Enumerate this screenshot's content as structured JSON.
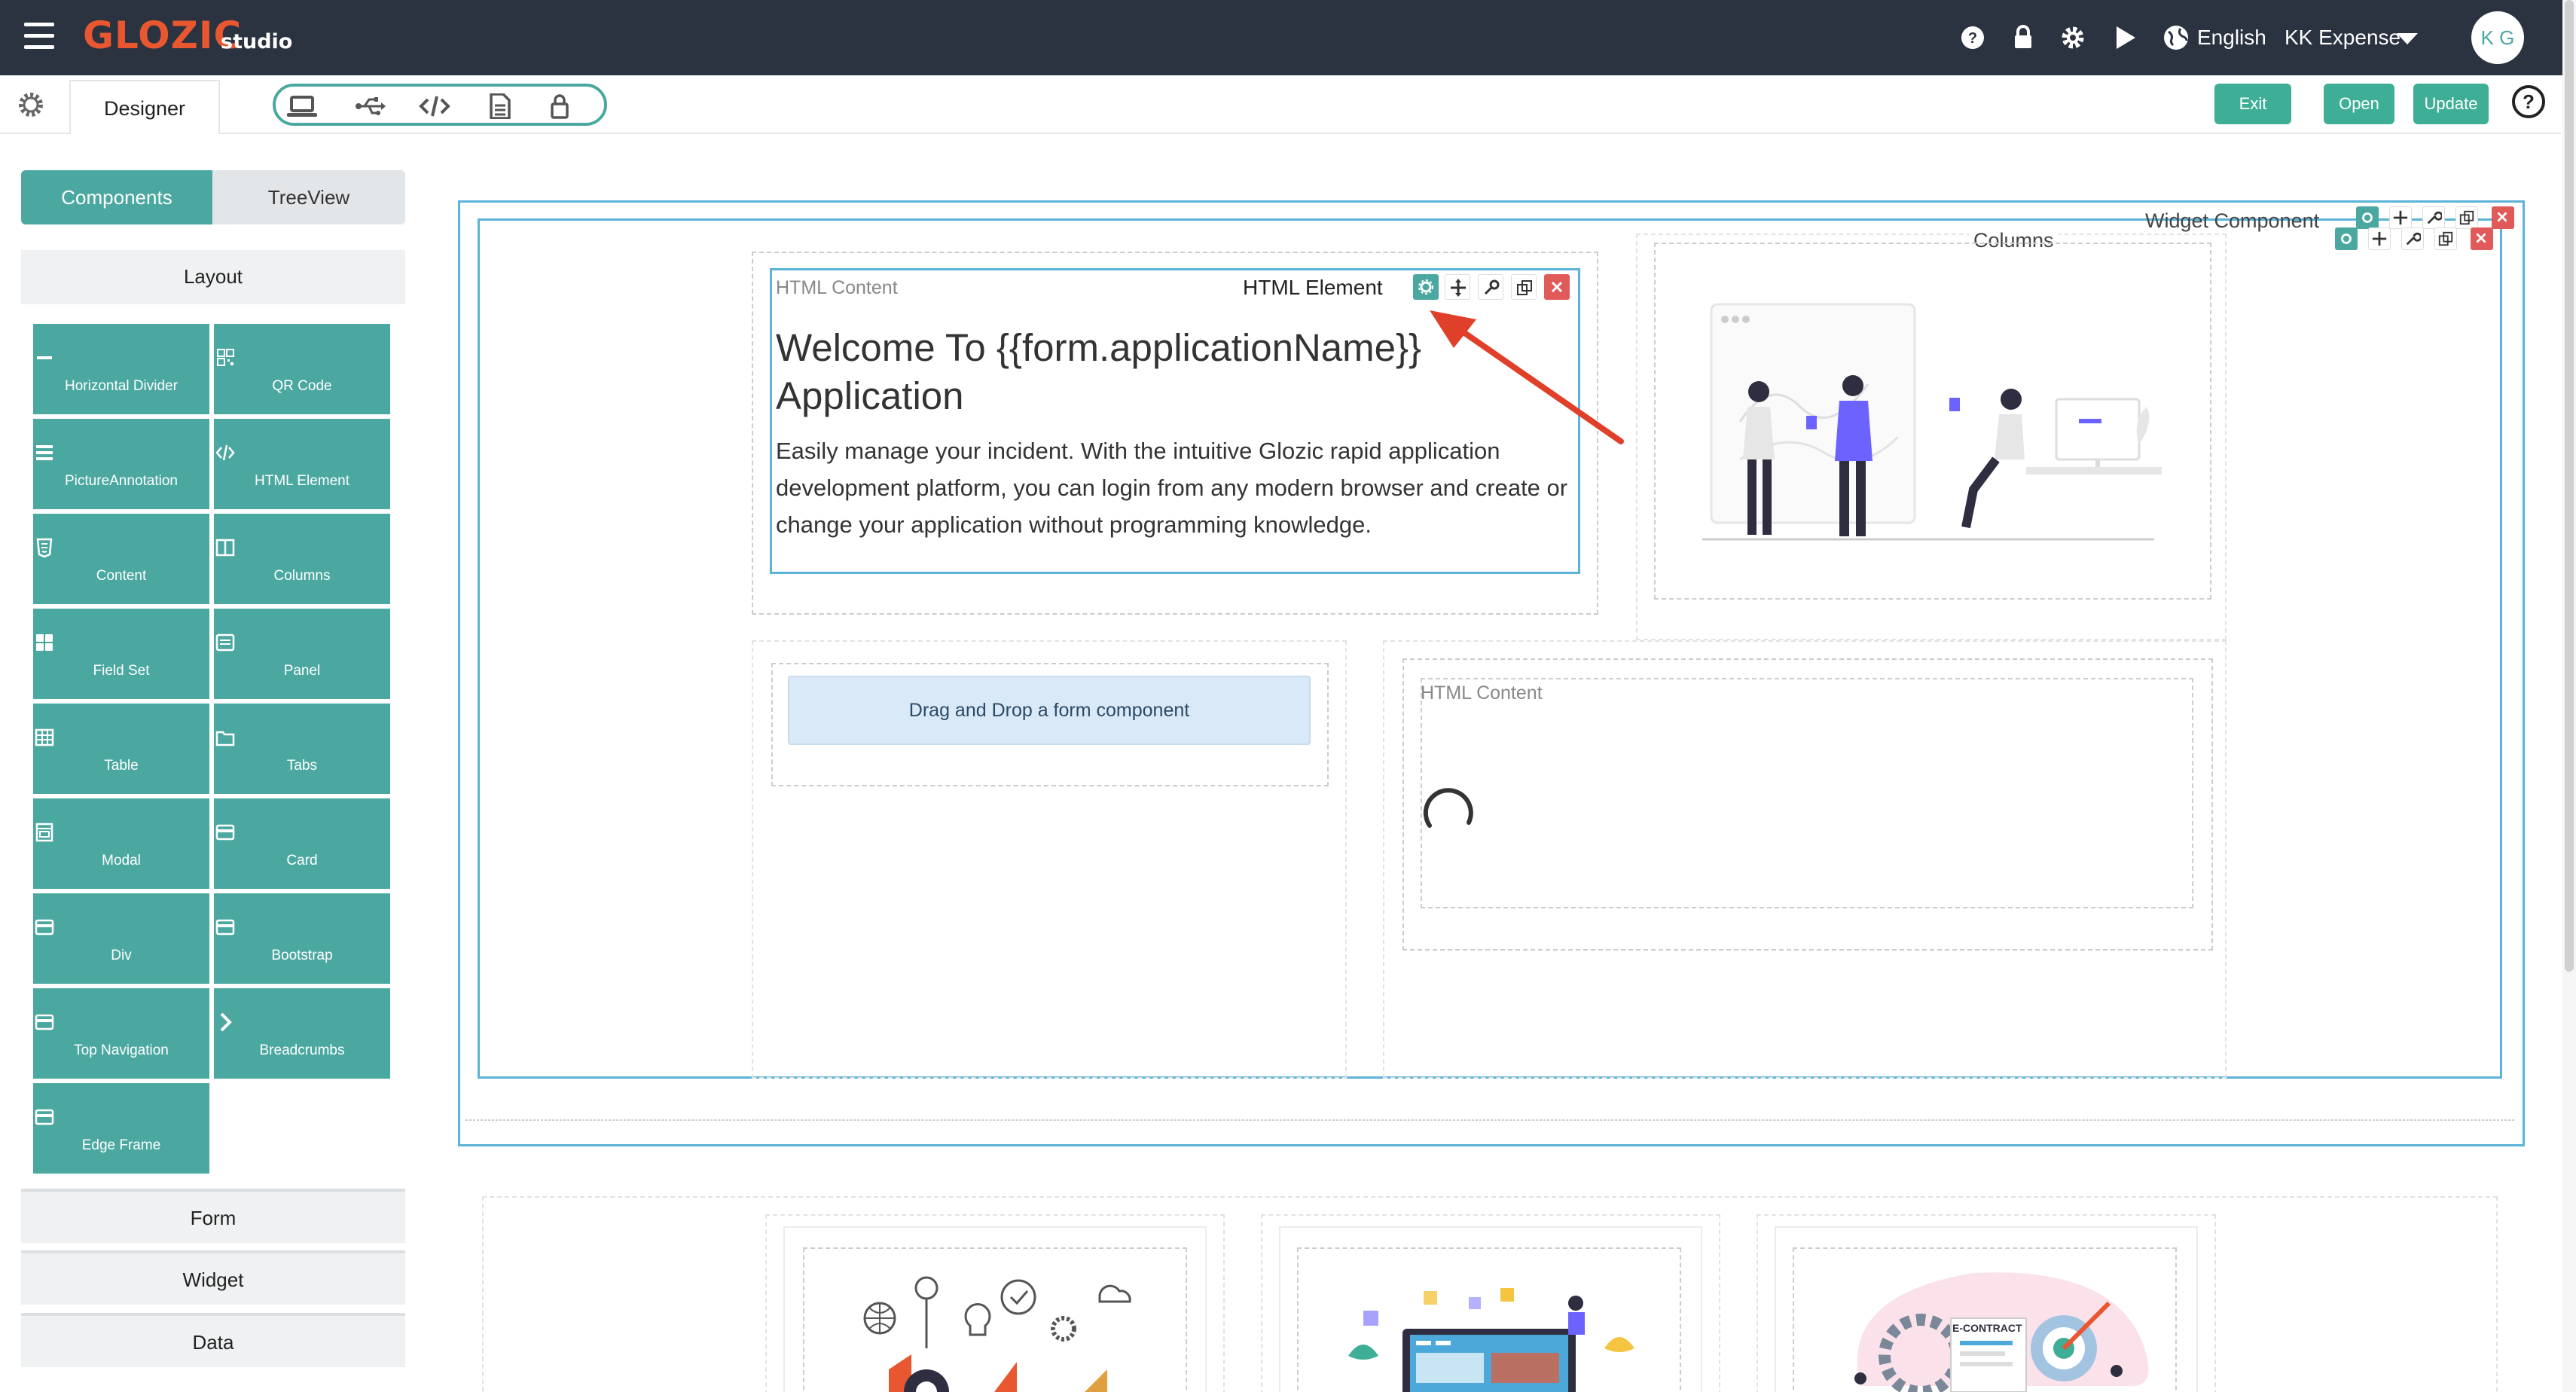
{
  "app": {
    "logo_text": "GLOZIC",
    "logo_sub": "studio",
    "language": "English",
    "account": "KK Expense",
    "avatar_initials": "K G"
  },
  "toolbar": {
    "designer_tab": "Designer",
    "exit_label": "Exit",
    "open_label": "Open",
    "update_label": "Update"
  },
  "left_panel": {
    "tab_components": "Components",
    "tab_treeview": "TreeView",
    "section_layout": "Layout",
    "components": [
      {
        "label": "Horizontal Divider",
        "icon": "minus-icon"
      },
      {
        "label": "QR Code",
        "icon": "qrcode-icon"
      },
      {
        "label": "PictureAnnotation",
        "icon": "bars-icon"
      },
      {
        "label": "HTML Element",
        "icon": "code-icon"
      },
      {
        "label": "Content",
        "icon": "html5-icon"
      },
      {
        "label": "Columns",
        "icon": "columns-icon"
      },
      {
        "label": "Field Set",
        "icon": "th-large-icon"
      },
      {
        "label": "Panel",
        "icon": "list-alt-icon"
      },
      {
        "label": "Table",
        "icon": "table-icon"
      },
      {
        "label": "Tabs",
        "icon": "folder-icon"
      },
      {
        "label": "Modal",
        "icon": "window-icon"
      },
      {
        "label": "Card",
        "icon": "card-icon"
      },
      {
        "label": "Div",
        "icon": "card-icon"
      },
      {
        "label": "Bootstrap",
        "icon": "card-icon"
      },
      {
        "label": "Top Navigation",
        "icon": "card-icon"
      },
      {
        "label": "Breadcrumbs",
        "icon": "chevron-right-icon"
      },
      {
        "label": "Edge Frame",
        "icon": "card-icon"
      }
    ],
    "section_form": "Form",
    "section_widget": "Widget",
    "section_data": "Data"
  },
  "canvas": {
    "widget_component_label": "Widget Component",
    "columns_label": "Columns",
    "html_content_label": "HTML Content",
    "html_element_label": "HTML Element",
    "welcome_heading": "Welcome To {{form.applicationName}} Application",
    "welcome_body": "Easily manage your incident. With the intuitive Glozic rapid application development platform, you can login from any modern browser and create or change your application without programming knowledge.",
    "drag_drop_label": "Drag and Drop a form component",
    "html_content_label_2": "HTML Content",
    "econtract_label": "E-CONTRACT"
  },
  "colors": {
    "topbar": "#2b3240",
    "accent": "#4ba8a0",
    "logo": "#e8572f",
    "danger": "#e05a5a",
    "select_border": "#5bb3d8",
    "arrow": "#e0402a"
  }
}
